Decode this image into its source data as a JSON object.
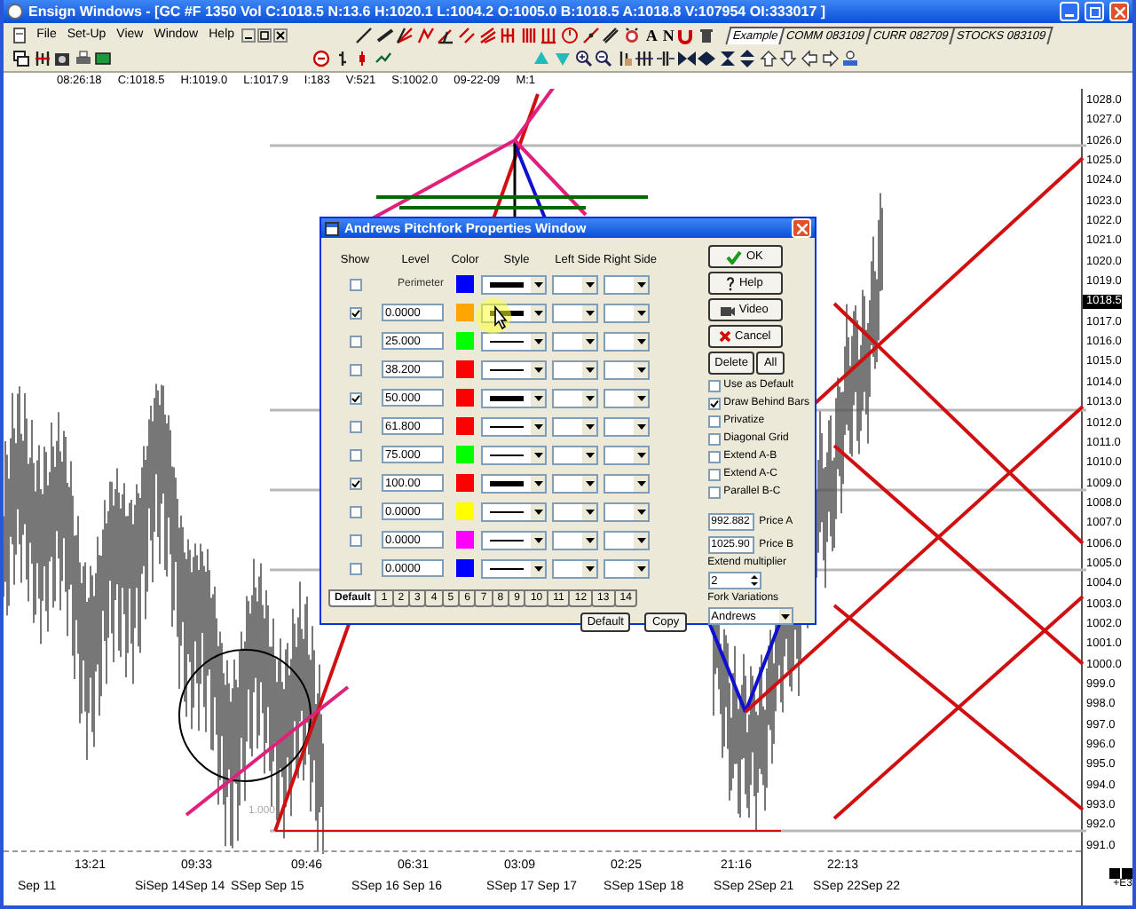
{
  "window": {
    "title": "Ensign Windows - [GC #F 1350 Vol C:1018.5 N:13.6 H:1020.1 L:1004.2 O:1005.0 B:1018.5 A:1018.8 V:107954 OI:333017 ]"
  },
  "menu": [
    "File",
    "Set-Up",
    "View",
    "Window",
    "Help"
  ],
  "toolbar_letters": [
    "A",
    "N"
  ],
  "chart_tabs": [
    {
      "label": "Example",
      "selected": true
    },
    {
      "label": "COMM 083109",
      "selected": false
    },
    {
      "label": "CURR 082709",
      "selected": false
    },
    {
      "label": "STOCKS 083109",
      "selected": false
    }
  ],
  "status_line": [
    "08:26:18",
    "C:1018.5",
    "H:1019.0",
    "L:1017.9",
    "I:183",
    "V:521",
    "S:1002.0",
    "09-22-09",
    "M:1"
  ],
  "chart_labels": [
    "1.000"
  ],
  "price_axis": {
    "labels": [
      "1028.0",
      "1027.0",
      "1026.0",
      "1025.0",
      "1024.0",
      "1023.0",
      "1022.0",
      "1021.0",
      "1020.0",
      "1019.0",
      "1017.0",
      "1016.0",
      "1015.0",
      "1014.0",
      "1013.0",
      "1012.0",
      "1011.0",
      "1010.0",
      "1009.0",
      "1008.0",
      "1007.0",
      "1006.0",
      "1005.0",
      "1004.0",
      "1003.0",
      "1002.0",
      "1001.0",
      "1000.0",
      "999.0",
      "998.0",
      "997.0",
      "996.0",
      "995.0",
      "994.0",
      "993.0",
      "992.0",
      "991.0"
    ],
    "current": "1018.5",
    "multiplier": "+E3"
  },
  "time_axis": {
    "times": [
      "13:21",
      "09:33",
      "09:46",
      "06:31",
      "03:09",
      "02:25",
      "21:16",
      "22:13"
    ],
    "dates": [
      "Sep 11",
      "SiSep 14Sep 14",
      "SSep Sep 15",
      "SSep 16 Sep 16",
      "SSep 17 Sep 17",
      "SSep 1Sep 18",
      "SSep 2Sep 21",
      "SSep 22Sep 22"
    ]
  },
  "dialog": {
    "title": "Andrews Pitchfork Properties Window",
    "columns": [
      "Show",
      "Level",
      "Color",
      "Style",
      "Left Side",
      "Right Side"
    ],
    "rows": [
      {
        "show": false,
        "kind": "label",
        "level": "Perimeter",
        "color": "#0000ff",
        "thick": true
      },
      {
        "show": true,
        "kind": "field",
        "level": "0.0000",
        "color": "#ffa500",
        "thick": true
      },
      {
        "show": false,
        "kind": "field",
        "level": "25.000",
        "color": "#00ff00",
        "thick": false
      },
      {
        "show": false,
        "kind": "field",
        "level": "38.200",
        "color": "#ff0000",
        "thick": false
      },
      {
        "show": true,
        "kind": "field",
        "level": "50.000",
        "color": "#ff0000",
        "thick": true
      },
      {
        "show": false,
        "kind": "field",
        "level": "61.800",
        "color": "#ff0000",
        "thick": false
      },
      {
        "show": false,
        "kind": "field",
        "level": "75.000",
        "color": "#00ff00",
        "thick": false
      },
      {
        "show": true,
        "kind": "field",
        "level": "100.00",
        "color": "#ff0000",
        "thick": true
      },
      {
        "show": false,
        "kind": "field",
        "level": "0.0000",
        "color": "#ffff00",
        "thick": false
      },
      {
        "show": false,
        "kind": "field",
        "level": "0.0000",
        "color": "#ff00ff",
        "thick": false
      },
      {
        "show": false,
        "kind": "field",
        "level": "0.0000",
        "color": "#0000ff",
        "thick": false
      }
    ],
    "tabs": [
      {
        "label": "Default",
        "selected": true
      },
      {
        "label": "1",
        "selected": false
      },
      {
        "label": "2",
        "selected": false
      },
      {
        "label": "3",
        "selected": false
      },
      {
        "label": "4",
        "selected": false
      },
      {
        "label": "5",
        "selected": false
      },
      {
        "label": "6",
        "selected": false
      },
      {
        "label": "7",
        "selected": false
      },
      {
        "label": "8",
        "selected": false
      },
      {
        "label": "9",
        "selected": false
      },
      {
        "label": "10",
        "selected": false
      },
      {
        "label": "11",
        "selected": false
      },
      {
        "label": "12",
        "selected": false
      },
      {
        "label": "13",
        "selected": false
      },
      {
        "label": "14",
        "selected": false
      }
    ],
    "bottom_buttons": [
      "Default",
      "Copy"
    ],
    "buttons": [
      {
        "kind": "ok",
        "label": "OK"
      },
      {
        "kind": "help",
        "label": "Help"
      },
      {
        "kind": "video",
        "label": "Video"
      },
      {
        "kind": "cancel",
        "label": "Cancel"
      }
    ],
    "delete_label": "Delete",
    "all_label": "All",
    "options": [
      {
        "label": "Use as Default",
        "checked": false
      },
      {
        "label": "Draw Behind Bars",
        "checked": true
      },
      {
        "label": "Privatize",
        "checked": false
      },
      {
        "label": "Diagonal Grid",
        "checked": false
      },
      {
        "label": "Extend A-B",
        "checked": false
      },
      {
        "label": "Extend A-C",
        "checked": false
      },
      {
        "label": "Parallel B-C",
        "checked": false
      }
    ],
    "prices": [
      {
        "value": "992.882",
        "label": "Price A"
      },
      {
        "value": "1025.90",
        "label": "Price B"
      }
    ],
    "extend": {
      "label": "Extend multiplier",
      "value": "2"
    },
    "fork": {
      "label": "Fork Variations",
      "value": "Andrews"
    }
  }
}
